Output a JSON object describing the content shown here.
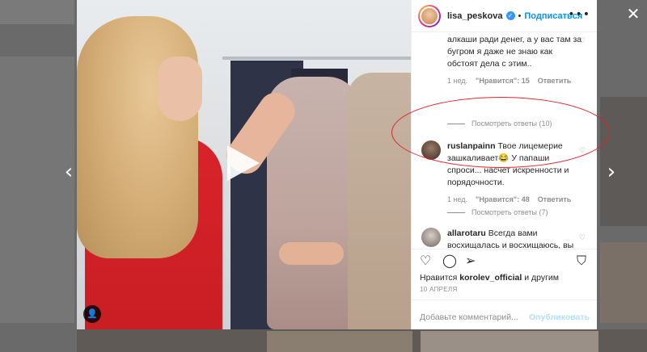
{
  "header": {
    "username": "lisa_peskova",
    "separator": "•",
    "follow_label": "Подписаться",
    "more_icon": "more-dots-icon"
  },
  "comments": [
    {
      "id": "partial",
      "text": "алкаши ради денег, а у вас там за бугром я даже не знаю как обстоят дела с этим..",
      "time": "1 нед.",
      "likes": "\"Нравится\": 15",
      "reply_label": "Ответить",
      "view_replies": "Посмотреть ответы (10)"
    },
    {
      "id": "ruslanpainn",
      "username": "ruslanpainn",
      "text": "Твое лицемерие зашкаливает😂 У папаши спроси... насчет искренности и порядочности.",
      "time": "1 нед.",
      "likes": "\"Нравится\": 48",
      "reply_label": "Ответить",
      "view_replies": "Посмотреть ответы (7)"
    },
    {
      "id": "allarotaru",
      "username": "allarotaru",
      "text": "Всегда вами восхищалась и восхищаюсь, вы очень мудрая и правильная девушка 🙏🙏🙏🌟🌟🌟"
    }
  ],
  "post": {
    "likes_prefix": "Нравится",
    "liked_by": "korolev_official",
    "likes_suffix": "и другим",
    "date": "10 АПРЕЛЯ"
  },
  "composer": {
    "placeholder": "Добавьте комментарий...",
    "publish_label": "Опубликовать"
  },
  "icons": {
    "heart": "heart-icon",
    "comment": "comment-icon",
    "share": "share-icon",
    "save": "bookmark-icon",
    "close": "close-icon",
    "prev": "chevron-left-icon",
    "next": "chevron-right-icon",
    "play": "play-icon",
    "tag": "user-tag-icon"
  },
  "colors": {
    "accent": "#0095f6",
    "highlight": "#e0242b",
    "verified": "#3897f0"
  }
}
